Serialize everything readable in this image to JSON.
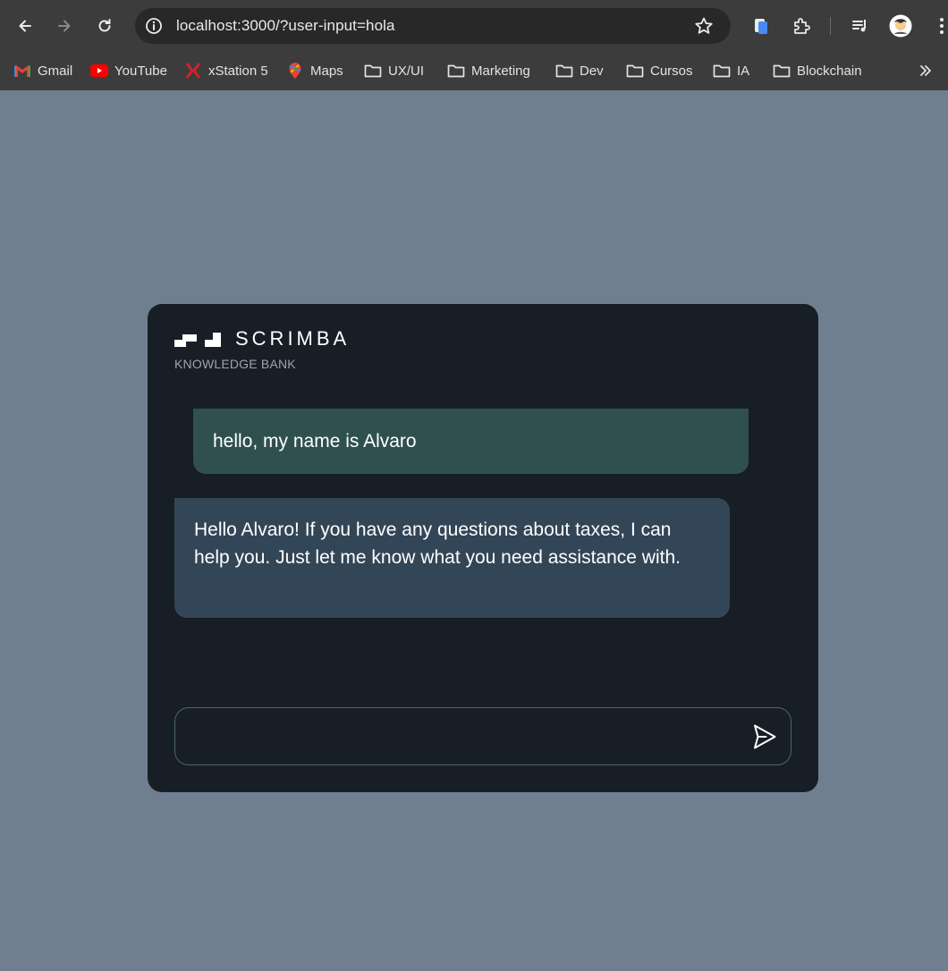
{
  "browser": {
    "url": "localhost:3000/?user-input=hola",
    "back_icon": "arrow-left-icon",
    "forward_icon": "arrow-right-icon",
    "reload_icon": "reload-icon",
    "info_icon": "info-icon",
    "star_icon": "star-icon",
    "toolbar_icons": [
      "extension-blue-icon",
      "puzzle-icon",
      "media-queue-icon",
      "avatar",
      "kebab-menu-icon"
    ]
  },
  "bookmarks": [
    {
      "label": "Gmail",
      "icon": "gmail-icon"
    },
    {
      "label": "YouTube",
      "icon": "youtube-icon"
    },
    {
      "label": "xStation 5",
      "icon": "xstation-icon"
    },
    {
      "label": "Maps",
      "icon": "maps-icon"
    },
    {
      "label": "UX/UI",
      "icon": "folder-icon"
    },
    {
      "label": "Marketing",
      "icon": "folder-icon"
    },
    {
      "label": "Dev",
      "icon": "folder-icon"
    },
    {
      "label": "Cursos",
      "icon": "folder-icon"
    },
    {
      "label": "IA",
      "icon": "folder-icon"
    },
    {
      "label": "Blockchain",
      "icon": "folder-icon"
    }
  ],
  "app": {
    "brand": "SCRIMBA",
    "subtitle": "KNOWLEDGE BANK",
    "messages": {
      "human": "hello, my name is Alvaro",
      "ai": "Hello Alvaro! If you have any questions about taxes, I can help you. Just let me know what you need assistance with."
    },
    "input_value": "",
    "send_icon": "send-icon"
  },
  "colors": {
    "page_bg": "#6f7f8f",
    "card_bg": "#171e26",
    "human_bubble": "#2f504e",
    "ai_bubble": "#334657",
    "chrome_bg": "#3c3c3c"
  }
}
